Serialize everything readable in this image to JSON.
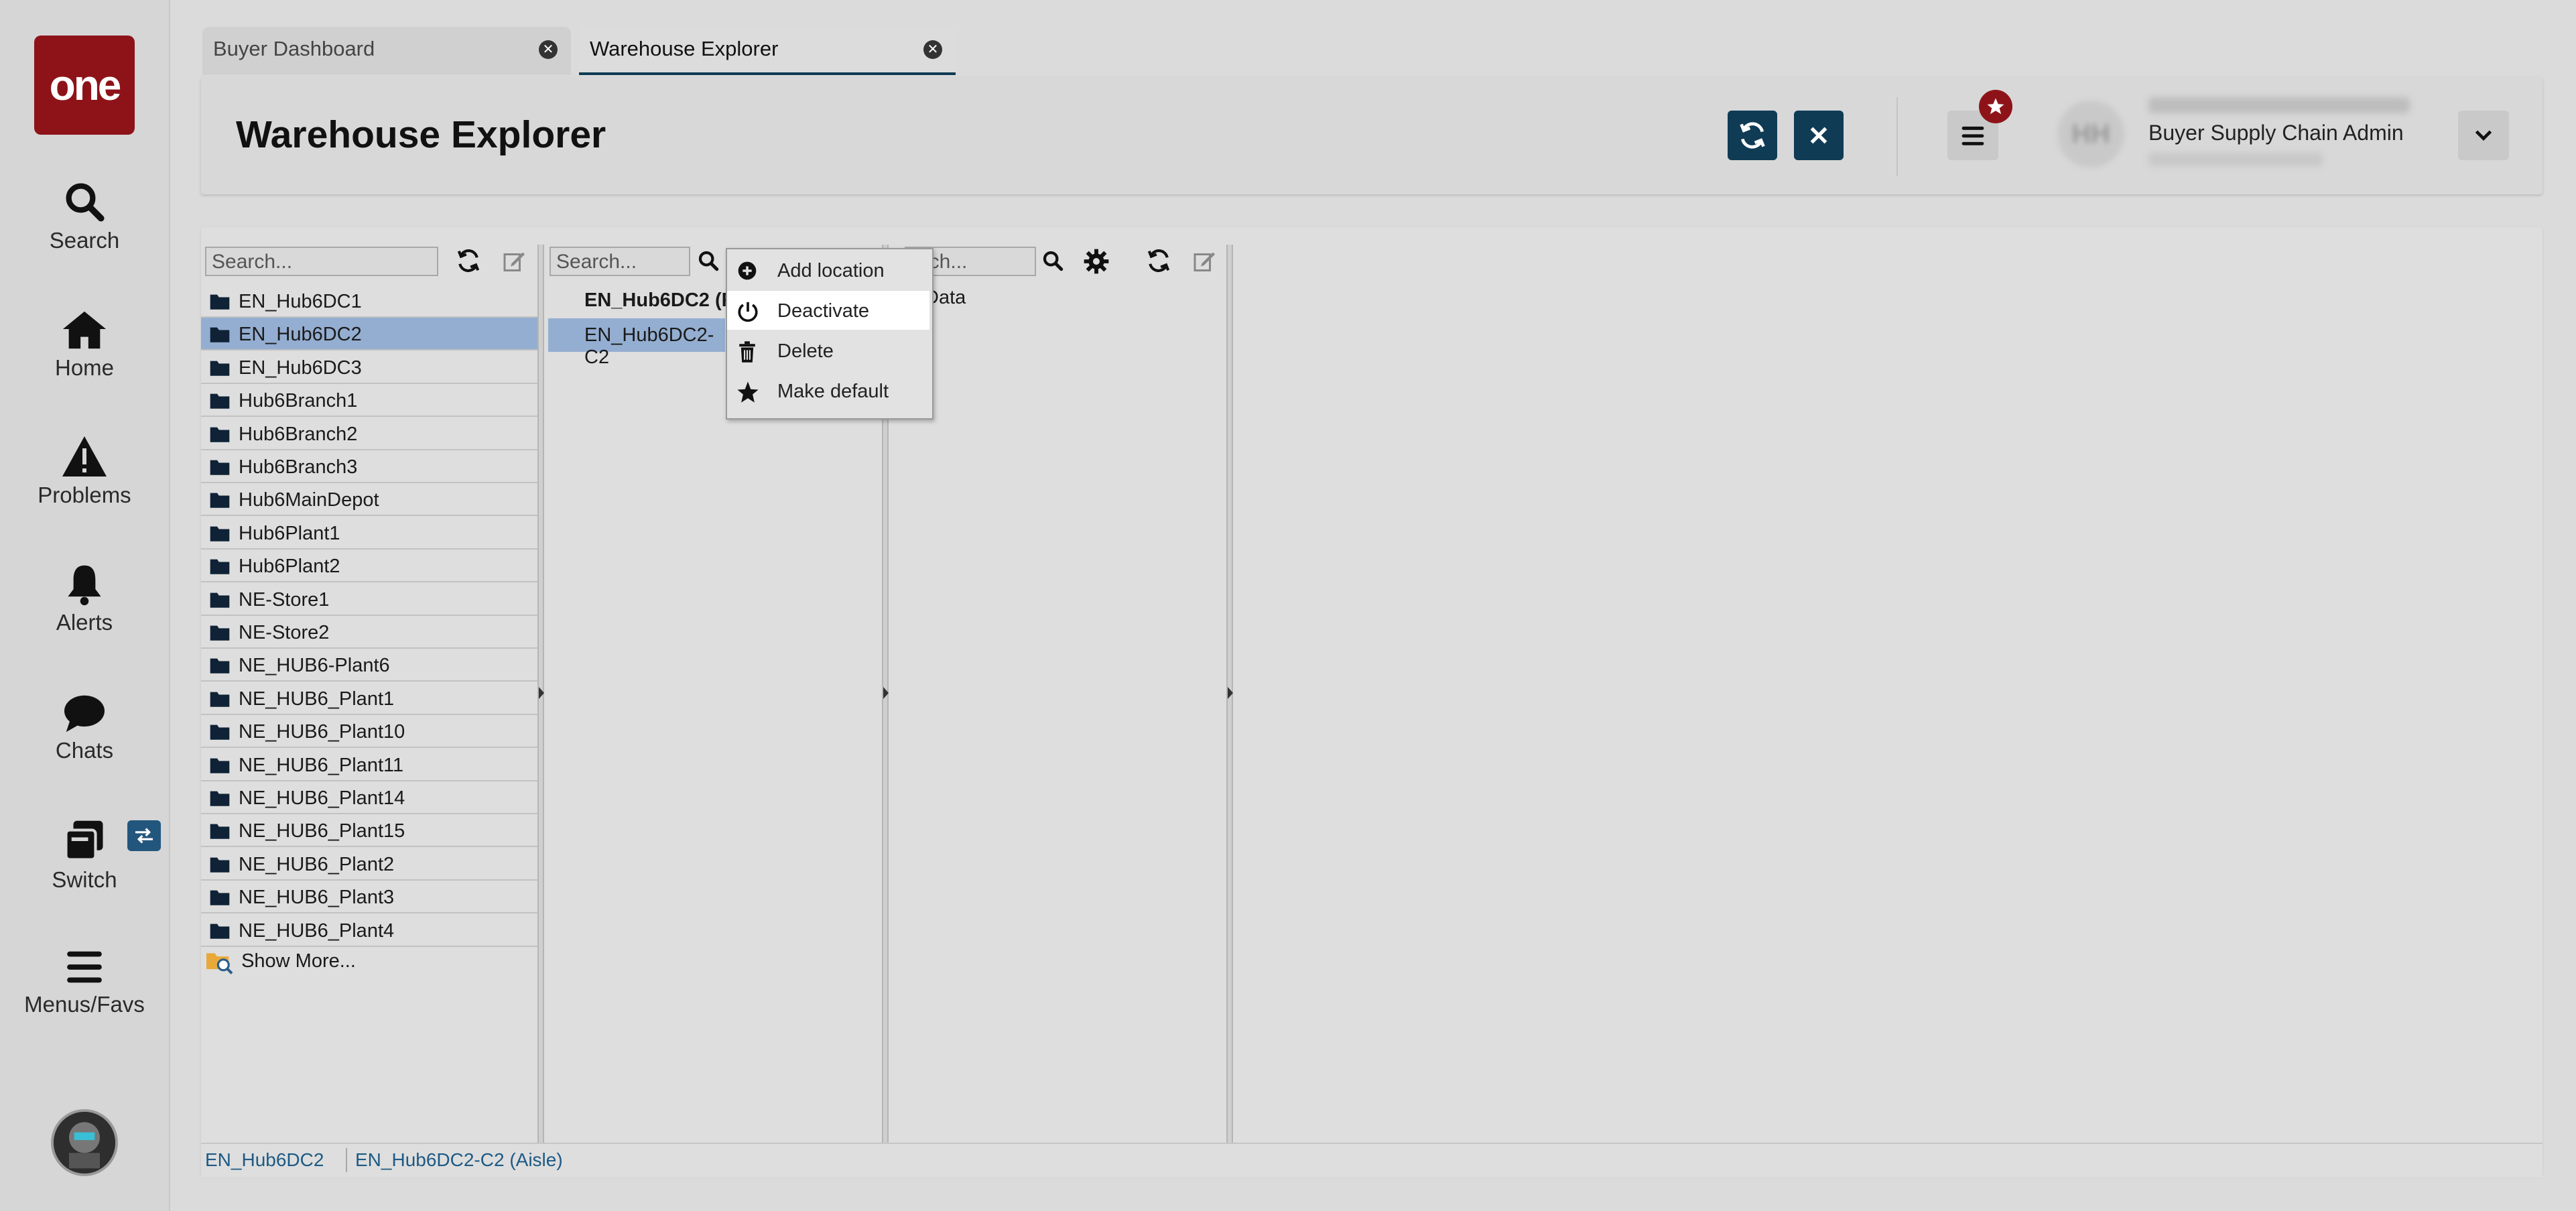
{
  "app": {
    "logo_text": "one",
    "brand_color": "#8e1318",
    "accent_color": "#0f3b55"
  },
  "sidebar": {
    "items": [
      {
        "label": "Search",
        "icon": "search-icon"
      },
      {
        "label": "Home",
        "icon": "home-icon"
      },
      {
        "label": "Problems",
        "icon": "warning-icon"
      },
      {
        "label": "Alerts",
        "icon": "bell-icon"
      },
      {
        "label": "Chats",
        "icon": "chat-icon"
      },
      {
        "label": "Switch",
        "icon": "switch-icon"
      },
      {
        "label": "Menus/Favs",
        "icon": "hamburger-icon"
      }
    ]
  },
  "tabs": [
    {
      "label": "Buyer Dashboard",
      "active": false
    },
    {
      "label": "Warehouse Explorer",
      "active": true
    }
  ],
  "header": {
    "title": "Warehouse Explorer",
    "user_initials": "HH",
    "user_role": "Buyer Supply Chain Admin"
  },
  "col1": {
    "search_placeholder": "Search...",
    "items": [
      "EN_Hub6DC1",
      "EN_Hub6DC2",
      "EN_Hub6DC3",
      "Hub6Branch1",
      "Hub6Branch2",
      "Hub6Branch3",
      "Hub6MainDepot",
      "Hub6Plant1",
      "Hub6Plant2",
      "NE-Store1",
      "NE-Store2",
      "NE_HUB6-Plant6",
      "NE_HUB6_Plant1",
      "NE_HUB6_Plant10",
      "NE_HUB6_Plant11",
      "NE_HUB6_Plant14",
      "NE_HUB6_Plant15",
      "NE_HUB6_Plant2",
      "NE_HUB6_Plant3",
      "NE_HUB6_Plant4"
    ],
    "selected": "EN_Hub6DC2",
    "show_more": "Show More..."
  },
  "col2": {
    "search_placeholder": "Search...",
    "item_header": "EN_Hub6DC2 (F",
    "item_selected": "EN_Hub6DC2-C2"
  },
  "col3": {
    "search_placeholder": "arch...",
    "item": "Data"
  },
  "context_menu": {
    "items": [
      {
        "label": "Add location",
        "icon": "plus-circle-icon"
      },
      {
        "label": "Deactivate",
        "icon": "power-icon"
      },
      {
        "label": "Delete",
        "icon": "trash-icon"
      },
      {
        "label": "Make default",
        "icon": "star-icon"
      }
    ]
  },
  "statusbar": {
    "crumb1": "EN_Hub6DC2",
    "crumb2": "EN_Hub6DC2-C2 (Aisle)"
  }
}
